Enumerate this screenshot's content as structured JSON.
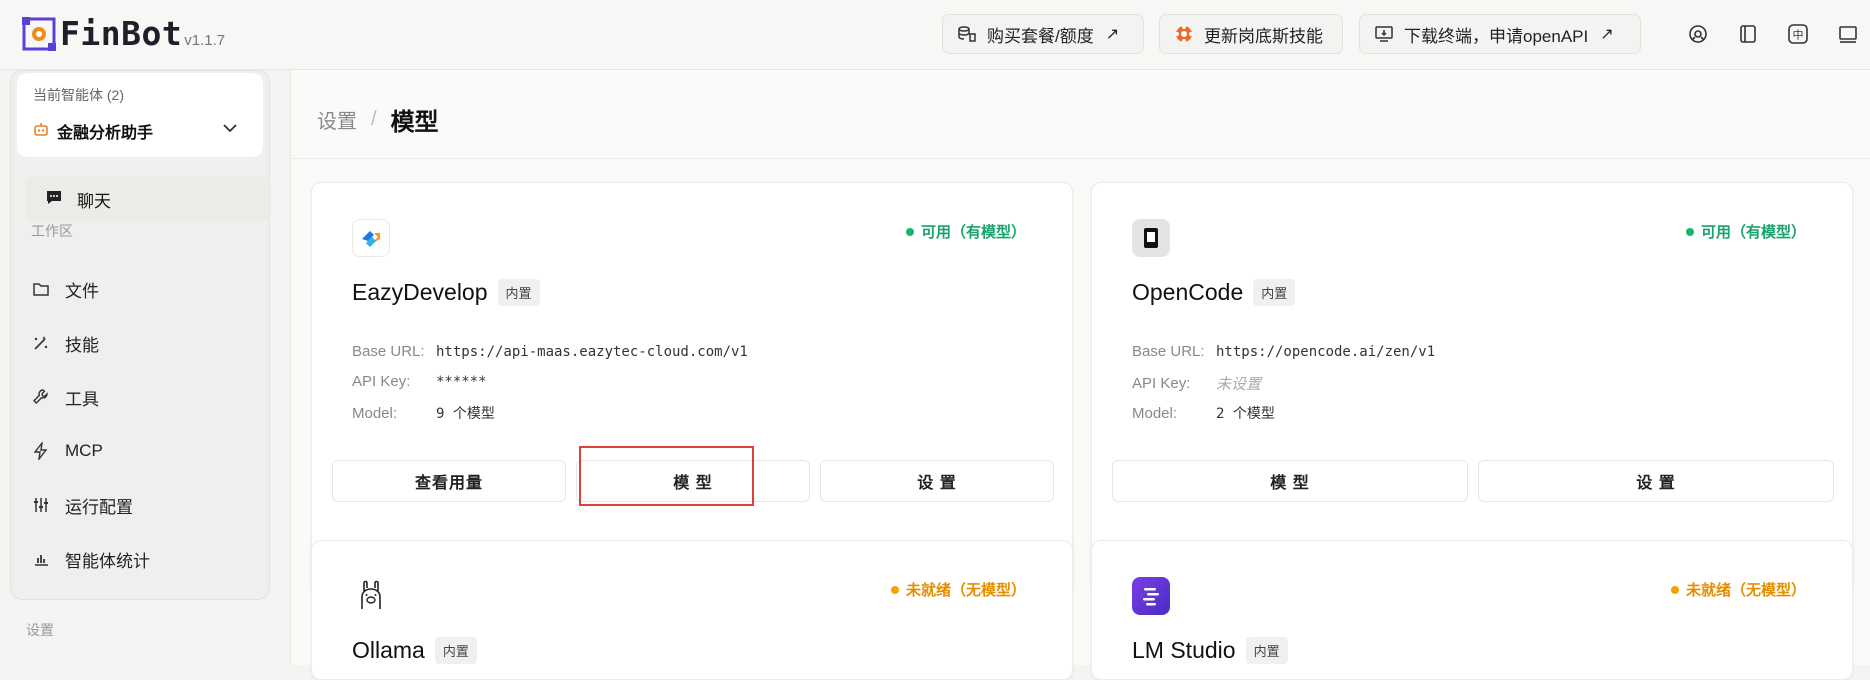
{
  "app": {
    "name": "FinBot",
    "version": "v1.1.7"
  },
  "topbar": {
    "buy_label": "购买套餐/额度",
    "skills_label": "更新岗底斯技能",
    "download_label": "下载终端，申请openAPI",
    "icons": [
      "help-icon",
      "book-icon",
      "language-icon",
      "layout-icon"
    ]
  },
  "sidebar": {
    "agent_label": "当前智能体 (2)",
    "agent_name": "金融分析助手",
    "chat_label": "聊天",
    "workspace_label": "工作区",
    "items": [
      {
        "label": "文件",
        "icon": "folder-icon"
      },
      {
        "label": "技能",
        "icon": "magic-icon"
      },
      {
        "label": "工具",
        "icon": "wrench-icon"
      },
      {
        "label": "MCP",
        "icon": "bolt-icon"
      },
      {
        "label": "运行配置",
        "icon": "sliders-icon"
      },
      {
        "label": "智能体统计",
        "icon": "bar-chart-icon"
      }
    ],
    "settings_label": "设置"
  },
  "breadcrumb": {
    "parent": "设置",
    "separator": "/",
    "current": "模型"
  },
  "labels": {
    "base_url": "Base URL:",
    "api_key": "API Key:",
    "model": "Model:"
  },
  "providers": [
    {
      "name": "EazyDevelop",
      "badge": "内置",
      "status": "可用（有模型）",
      "base_url": "https://api-maas.eazytec-cloud.com/v1",
      "api_key": "******",
      "model": "9 个模型",
      "buttons": [
        "查看用量",
        "模 型",
        "设 置"
      ]
    },
    {
      "name": "OpenCode",
      "badge": "内置",
      "status": "可用（有模型）",
      "base_url": "https://opencode.ai/zen/v1",
      "api_key": "未设置",
      "model": "2 个模型",
      "buttons": [
        "模 型",
        "设 置"
      ]
    },
    {
      "name": "Ollama",
      "badge": "内置",
      "status": "未就绪（无模型）"
    },
    {
      "name": "LM Studio",
      "badge": "内置",
      "status": "未就绪（无模型）"
    }
  ],
  "colors": {
    "available": "#18b26d",
    "not_ready": "#f5a100",
    "highlight": "#e0403a"
  }
}
